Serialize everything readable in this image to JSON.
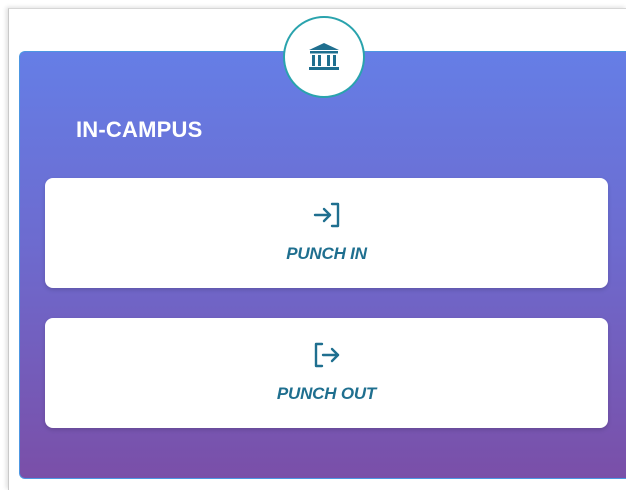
{
  "card": {
    "badge_icon": "bank-icon",
    "title": "IN-CAMPUS"
  },
  "actions": [
    {
      "label": "PUNCH IN",
      "icon": "login-icon"
    },
    {
      "label": "PUNCH OUT",
      "icon": "logout-icon"
    }
  ],
  "colors": {
    "gradient_top": "#657ee6",
    "gradient_bottom": "#7a4fa8",
    "accent_teal": "#2aa3ad",
    "label_text": "#1f6f8f",
    "card_border": "#4d97e2"
  }
}
